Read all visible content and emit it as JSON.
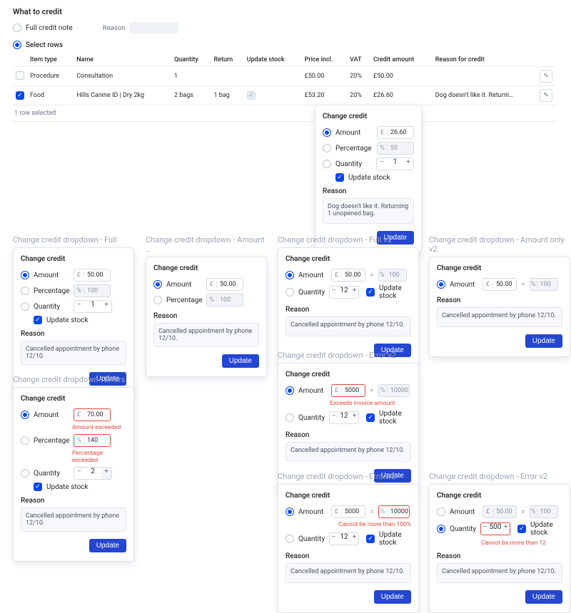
{
  "title": "What to credit",
  "radios": {
    "full": "Full credit note",
    "select": "Select rows",
    "reason_label": "Reason"
  },
  "table": {
    "headers": {
      "item_type": "Item type",
      "name": "Name",
      "quantity": "Quantity",
      "return": "Return",
      "update_stock": "Update stock",
      "price_incl": "Price incl.",
      "vat": "VAT",
      "credit_amount": "Credit amount",
      "reason": "Reason for credit"
    },
    "rows": [
      {
        "checked": false,
        "item_type": "Procedure",
        "name": "Consultation",
        "quantity": "1",
        "return": "",
        "update_stock": "",
        "price": "£50.00",
        "vat": "20%",
        "credit": "£50.00",
        "reason": ""
      },
      {
        "checked": true,
        "item_type": "Food",
        "name": "Hills Canine ID | Dry 2kg",
        "quantity": "2 bags",
        "return": "1 bag",
        "update_stock": "✓",
        "price": "£53.20",
        "vat": "20%",
        "credit": "£26.60",
        "reason": "Dog doesn't like it. Returni…"
      }
    ],
    "footer": "1 row selected"
  },
  "pop": {
    "title": "Change credit",
    "amount": "Amount",
    "percentage": "Percentage",
    "quantity": "Quantity",
    "update_stock": "Update stock",
    "reason_label": "Reason",
    "update_btn": "Update",
    "currency": "£",
    "percent": "%",
    "amount_val": "26.60",
    "percent_val": "50",
    "qty_val": "1",
    "reason_text": "Dog doesn't like it. Returning 1 unopened bag."
  },
  "common": {
    "change": "Change credit",
    "amount_label": "Amount",
    "percentage_label": "Percentage",
    "quantity_label": "Quantity",
    "update_stock_label": "Update stock",
    "reason_label": "Reason",
    "update": "Update",
    "reason_default": "Cancelled appointment by phone 12/10."
  },
  "v": {
    "full": {
      "label": "Change credit dropdown - Full",
      "amount": "50.00",
      "pct": "100",
      "qty": "1"
    },
    "amount": {
      "label": "Change credit dropdown - Amount …",
      "amount": "50.00",
      "pct": "100"
    },
    "errors": {
      "label": "Change credit dropdown - Errors",
      "amount": "70.00",
      "pct": "140",
      "qty": "2",
      "err_amount": "Amount exceeded",
      "err_pct": "Percentage exceeded"
    },
    "full_v2": {
      "label": "Change credit dropdown - Full v2",
      "amount": "50.00",
      "pct": "100",
      "qty": "12"
    },
    "amount_v2": {
      "label": "Change credit dropdown - Amount only v2",
      "amount": "50.00",
      "pct": "100"
    },
    "err_v2_a": {
      "label": "Change credit dropdown - Error v2",
      "amount": "5000",
      "pct": "10000",
      "qty": "12",
      "err": "Exceeds invoice amount"
    },
    "err_v2_b": {
      "label": "Change credit dropdown - Error v2",
      "amount": "5000",
      "pct": "10000",
      "qty": "12",
      "err": "Cannot be more than 100%"
    },
    "err_v2_c": {
      "label": "Change credit dropdown - Error v2",
      "amount": "50.00",
      "pct": "100",
      "qty": "500",
      "err": "Cannot be more than 12"
    }
  }
}
